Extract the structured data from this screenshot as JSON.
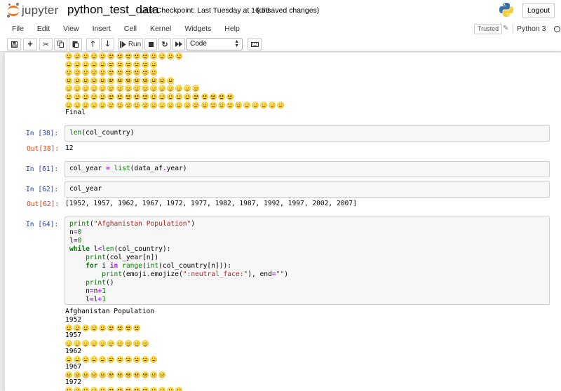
{
  "header": {
    "logo_text": "jupyter",
    "notebook_name": "python_test_data",
    "checkpoint": "Last Checkpoint: Last Tuesday at 16:50",
    "unsaved": "(unsaved changes)",
    "logout_label": "Logout"
  },
  "menubar": {
    "items": [
      "File",
      "Edit",
      "View",
      "Insert",
      "Cell",
      "Kernel",
      "Widgets",
      "Help"
    ],
    "trusted": "Trusted",
    "kernel": "Python 3"
  },
  "toolbar": {
    "run_label": "Run",
    "cell_type": "Code",
    "icons": [
      "save-icon",
      "add-cell-icon",
      "cut-icon",
      "copy-icon",
      "paste-icon",
      "move-up-icon",
      "move-down-icon",
      "run-icon",
      "stop-icon",
      "restart-icon",
      "fast-forward-icon",
      "keyboard-icon"
    ]
  },
  "top_output": {
    "emoji_rows": [
      14,
      11,
      11,
      13,
      16,
      20,
      26
    ],
    "final_text": "Final"
  },
  "cells": [
    {
      "prompt": "In [38]:",
      "code": "len(col_country)",
      "out_prompt": "Out[38]:",
      "output": "12"
    },
    {
      "prompt": "In [61]:",
      "code": "col_year = list(data_af.year)"
    },
    {
      "prompt": "In [62]:",
      "code": "col_year",
      "out_prompt": "Out[62]:",
      "output": "[1952, 1957, 1962, 1967, 1972, 1977, 1982, 1987, 1992, 1997, 2002, 2007]"
    },
    {
      "prompt": "In [64]:",
      "code_lines": [
        "print(\"Afghanistan Population\")",
        "n=0",
        "l=0",
        "while l<len(col_country):",
        "    print(col_year[n])",
        "    for i in range(int(col_country[n])):",
        "        print(emoji.emojize(\":neutral_face:\"), end=\"\")",
        "    print()",
        "    n=n+1",
        "    l=l+1"
      ]
    }
  ],
  "last_output": {
    "title": "Afghanistan Population",
    "blocks": [
      {
        "year": "1952",
        "count": 9
      },
      {
        "year": "1957",
        "count": 10
      },
      {
        "year": "1962",
        "count": 11
      },
      {
        "year": "1967",
        "count": 12
      },
      {
        "year": "1972",
        "count": 14
      }
    ]
  },
  "colors": {
    "prompt_in": "#303f9f",
    "prompt_out": "#d84315",
    "keyword": "#008000",
    "string": "#ba2121",
    "jupyter_orange": "#f37726"
  }
}
